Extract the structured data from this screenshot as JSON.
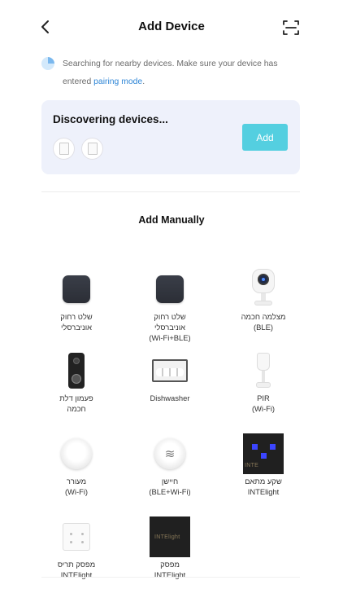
{
  "header": {
    "title": "Add Device",
    "back_icon": "chevron-left-icon",
    "scan_icon": "scan-icon"
  },
  "tip": {
    "text": "Searching for nearby devices. Make sure your device has entered ",
    "link": "pairing mode",
    "suffix": "."
  },
  "discover": {
    "title": "Discovering devices...",
    "add_label": "Add",
    "accent": "#54cfe0"
  },
  "manual": {
    "title": "Add Manually",
    "devices": [
      {
        "label": "שלט רחוק\nאוניברסלי"
      },
      {
        "label": "שלט רחוק\nאוניברסלי\n(Wi-Fi+BLE)"
      },
      {
        "label": "מצלמה חכמה\n(BLE)"
      },
      {
        "label": "פעמון דלת\nחכמה"
      },
      {
        "label": "Dishwasher"
      },
      {
        "label": "PIR\n(Wi-Fi)"
      },
      {
        "label": "מעורר\n(Wi-Fi)"
      },
      {
        "label": "חיישן\n(BLE+Wi-Fi)"
      },
      {
        "label": "שקע מתאם\nINTElight",
        "brand": "INTE"
      },
      {
        "label": "מפסק תריס\nINTElight"
      },
      {
        "label": "מפסק\nINTElight",
        "brand": "INTElight"
      }
    ]
  }
}
